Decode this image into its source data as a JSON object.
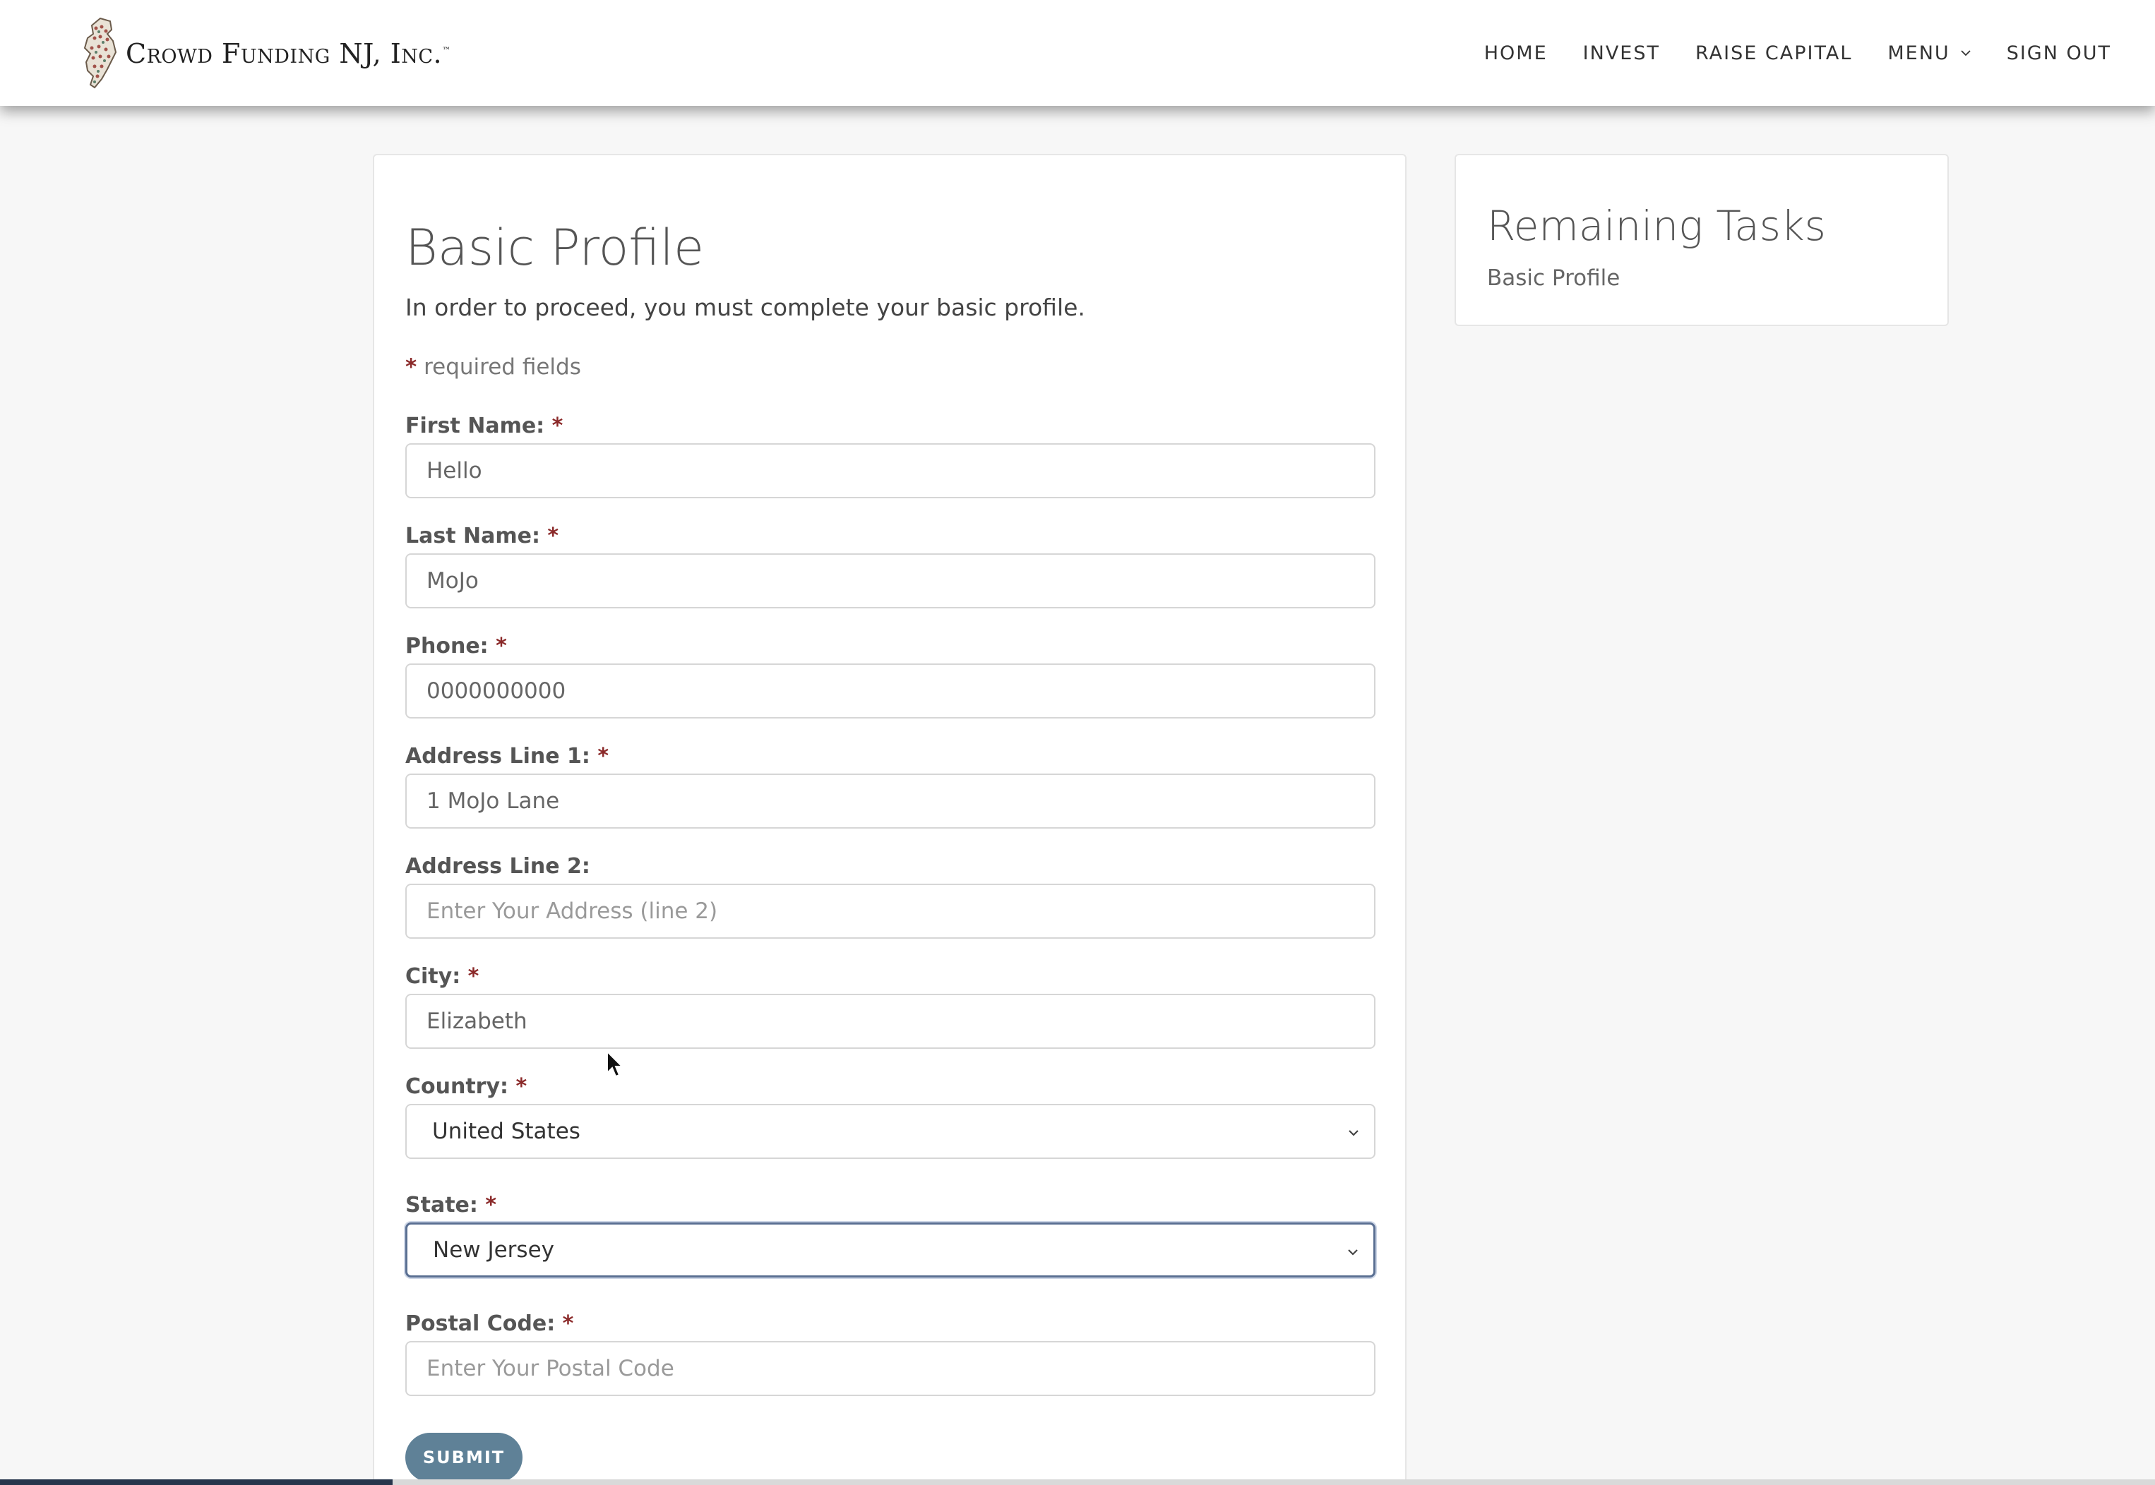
{
  "header": {
    "brand": "Crowd Funding NJ, Inc.",
    "brand_tm": "™",
    "nav": {
      "home": "HOME",
      "invest": "INVEST",
      "raise_capital": "RAISE CAPITAL",
      "menu": "MENU",
      "sign_out": "SIGN OUT"
    }
  },
  "form": {
    "title": "Basic Profile",
    "intro": "In order to proceed, you must complete your basic profile.",
    "required_note": "required fields",
    "required_mark": "*",
    "fields": {
      "first_name": {
        "label": "First Name:",
        "value": "Hello",
        "placeholder": ""
      },
      "last_name": {
        "label": "Last Name:",
        "value": "MoJo",
        "placeholder": ""
      },
      "phone": {
        "label": "Phone:",
        "value": "0000000000",
        "placeholder": ""
      },
      "address1": {
        "label": "Address Line 1:",
        "value": "1 MoJo Lane",
        "placeholder": ""
      },
      "address2": {
        "label": "Address Line 2:",
        "value": "",
        "placeholder": "Enter Your Address (line 2)"
      },
      "city": {
        "label": "City:",
        "value": "Elizabeth",
        "placeholder": ""
      },
      "country": {
        "label": "Country:",
        "selected": "United States"
      },
      "state": {
        "label": "State:",
        "selected": "New Jersey"
      },
      "postal": {
        "label": "Postal Code:",
        "value": "",
        "placeholder": "Enter Your Postal Code"
      }
    },
    "submit_label": "SUBMIT"
  },
  "sidebar": {
    "title": "Remaining Tasks",
    "tasks": [
      "Basic Profile"
    ]
  },
  "colors": {
    "accent_button": "#5f8197",
    "required_star": "#8b2a2a",
    "focus_border": "#5a6f92"
  },
  "icons": {
    "logo": "nj-state-logo-icon",
    "menu_dropdown": "chevron-down-icon",
    "select_dropdown": "chevron-down-icon",
    "cursor": "mouse-pointer-icon"
  }
}
